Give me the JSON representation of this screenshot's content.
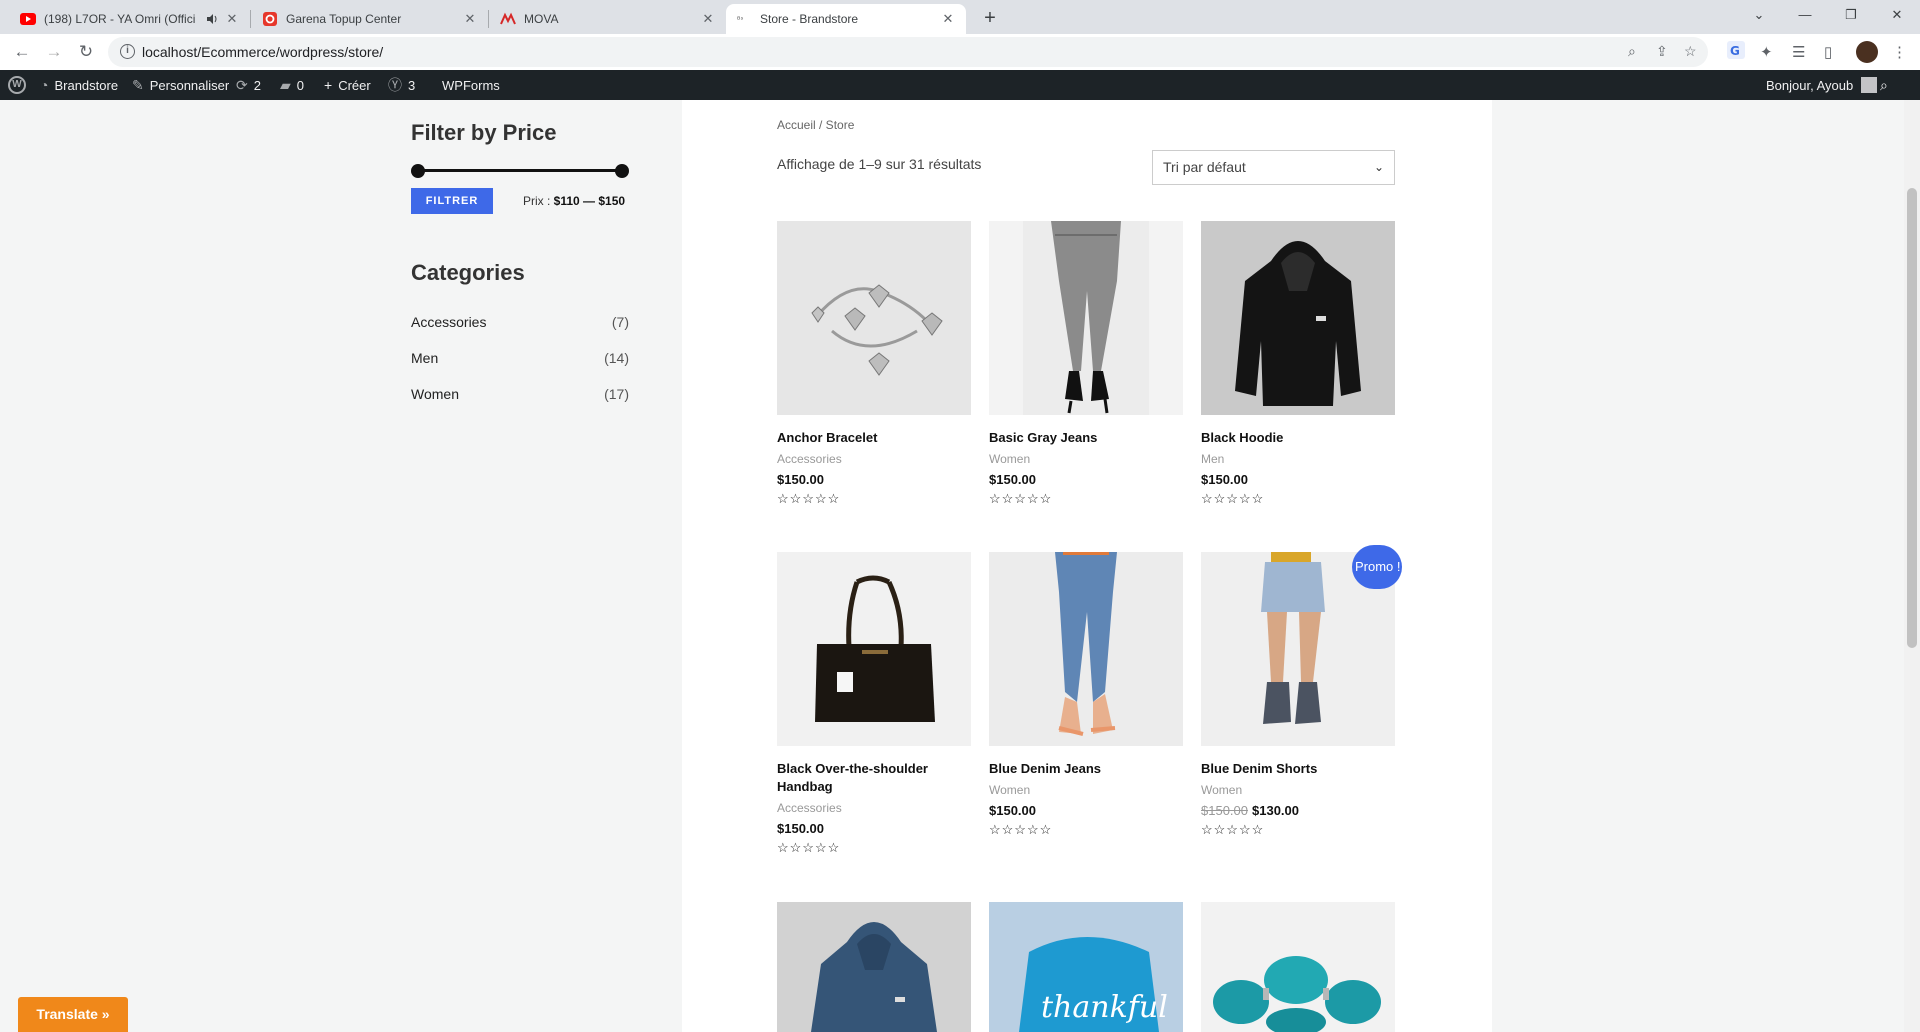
{
  "browser": {
    "tabs": [
      {
        "title": "(198) L7OR - YA Omri (Offici",
        "icon": "youtube-icon"
      },
      {
        "title": "Garena Topup Center",
        "icon": "garena-icon"
      },
      {
        "title": "MOVA",
        "icon": "mova-icon"
      },
      {
        "title": "Store - Brandstore",
        "icon": "brandstore-icon"
      }
    ],
    "url": "localhost/Ecommerce/wordpress/store/"
  },
  "adminbar": {
    "site": "Brandstore",
    "customize": "Personnaliser",
    "updates": "2",
    "comments": "0",
    "new": "Créer",
    "yoast": "3",
    "wpforms": "WPForms",
    "greeting": "Bonjour, Ayoub"
  },
  "sidebar": {
    "filter_title": "Filter by Price",
    "filter_button": "FILTRER",
    "price_prefix": "Prix : ",
    "price_range": "$110 — $150",
    "categories_title": "Categories",
    "categories": [
      {
        "name": "Accessories",
        "count": "(7)"
      },
      {
        "name": "Men",
        "count": "(14)"
      },
      {
        "name": "Women",
        "count": "(17)"
      }
    ]
  },
  "main": {
    "breadcrumb": "Accueil / Store",
    "result_count": "Affichage de 1–9 sur 31 résultats",
    "orderby": "Tri par défaut",
    "products": [
      {
        "name": "Anchor Bracelet",
        "category": "Accessories",
        "price": "$150.00",
        "old_price": "",
        "rating": 0
      },
      {
        "name": "Basic Gray Jeans",
        "category": "Women",
        "price": "$150.00",
        "old_price": "",
        "rating": 0
      },
      {
        "name": "Black Hoodie",
        "category": "Men",
        "price": "$150.00",
        "old_price": "",
        "rating": 0
      },
      {
        "name": "Black Over-the-shoulder Handbag",
        "category": "Accessories",
        "price": "$150.00",
        "old_price": "",
        "rating": 0
      },
      {
        "name": "Blue Denim Jeans",
        "category": "Women",
        "price": "$150.00",
        "old_price": "",
        "rating": 0
      },
      {
        "name": "Blue Denim Shorts",
        "category": "Women",
        "price": "$130.00",
        "old_price": "$150.00",
        "rating": 0
      }
    ],
    "promo_badge": "Promo !",
    "row3_tshirt_text": "thankful"
  },
  "translate_button": "Translate »"
}
